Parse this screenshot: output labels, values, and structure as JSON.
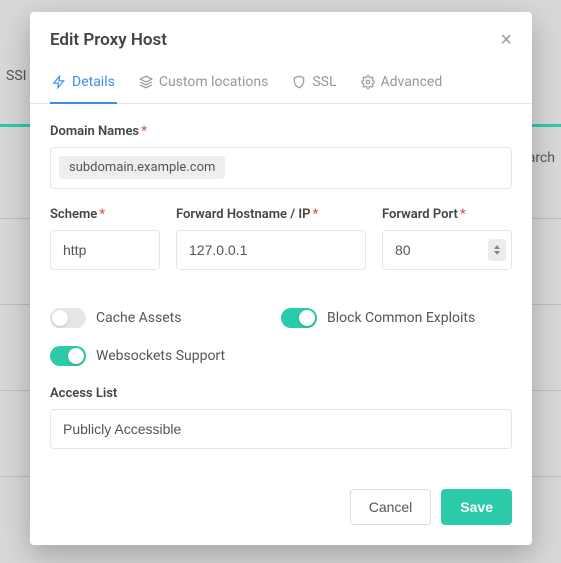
{
  "backdrop": {
    "left_cut": "SSI",
    "right_cut": "Search"
  },
  "modal": {
    "title": "Edit Proxy Host"
  },
  "tabs": {
    "details": "Details",
    "custom_locations": "Custom locations",
    "ssl": "SSL",
    "advanced": "Advanced"
  },
  "form": {
    "domain_label": "Domain Names",
    "domain_chip": "subdomain.example.com",
    "scheme_label": "Scheme",
    "scheme_value": "http",
    "host_label": "Forward Hostname / IP",
    "host_value": "127.0.0.1",
    "port_label": "Forward Port",
    "port_value": "80",
    "cache_assets": "Cache Assets",
    "block_exploits": "Block Common Exploits",
    "websockets": "Websockets Support",
    "access_list_label": "Access List",
    "access_list_value": "Publicly Accessible"
  },
  "buttons": {
    "cancel": "Cancel",
    "save": "Save"
  },
  "required_marker": "*"
}
